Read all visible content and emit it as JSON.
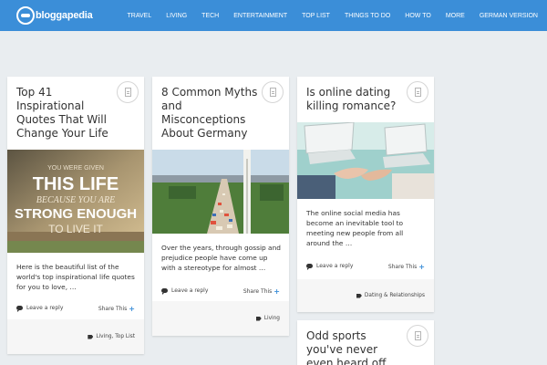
{
  "site": {
    "logo_text": "bloggapedia",
    "nav": [
      "TRAVEL",
      "LIVING",
      "TECH",
      "ENTERTAINMENT",
      "TOP LIST",
      "THINGS TO DO",
      "HOW TO",
      "MORE",
      "GERMAN VERSION"
    ]
  },
  "colors": {
    "header": "#3b8ed8",
    "page_bg": "#e9edf0",
    "card_footer": "#f6f6f6"
  },
  "posts": [
    {
      "title": "Top 41 Inspirational Quotes That Will Change Your Life",
      "image_caption": "YOU WERE GIVEN THIS LIFE BECAUSE YOU ARE STRONG ENOUGH TO LIVE IT",
      "excerpt": "Here is the beautiful list of the world's top inspirational life quotes for you to love, …",
      "reply": "Leave a reply",
      "share": "Share This",
      "tags": "Living, Top List"
    },
    {
      "title": "8 Common Myths and Misconceptions About Germany",
      "excerpt": "Over the years, through gossip and prejudice people have come up with a stereotype for almost …",
      "reply": "Leave a reply",
      "share": "Share This",
      "tags": "Living"
    },
    {
      "title": "Is online dating killing romance?",
      "excerpt": "The online social media has become an inevitable tool to meeting new people from all around the …",
      "reply": "Leave a reply",
      "share": "Share This",
      "tags": "Dating & Relationships"
    },
    {
      "title": "Odd sports you've never even heard off"
    }
  ]
}
